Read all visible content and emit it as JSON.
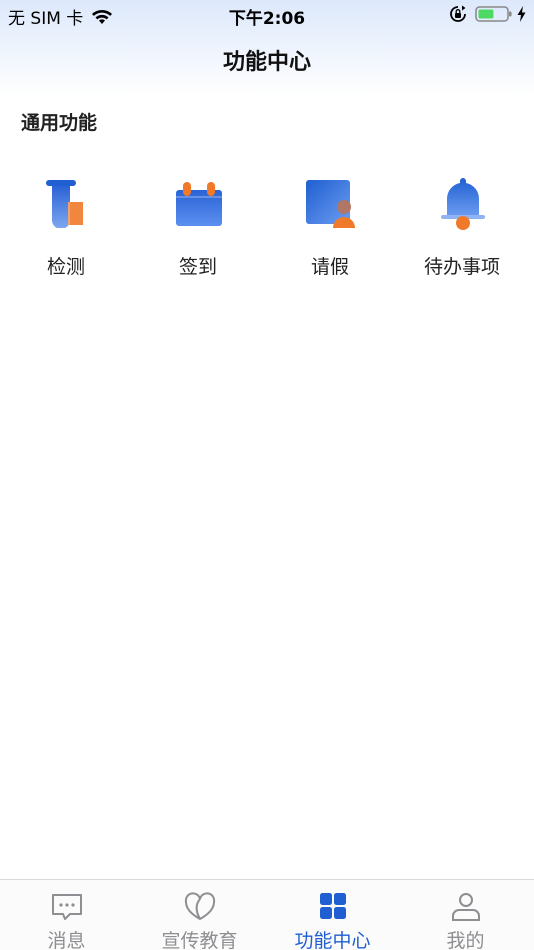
{
  "status_bar": {
    "carrier": "无 SIM 卡",
    "time": "下午2:06",
    "battery_level": 0.55,
    "icons": [
      "wifi-icon",
      "orientation-lock-icon",
      "battery-icon",
      "charging-icon"
    ]
  },
  "header": {
    "title": "功能中心"
  },
  "section": {
    "title": "通用功能"
  },
  "functions": [
    {
      "label": "检测",
      "icon": "test-tube-icon"
    },
    {
      "label": "签到",
      "icon": "calendar-checkin-icon"
    },
    {
      "label": "请假",
      "icon": "leave-request-icon"
    },
    {
      "label": "待办事项",
      "icon": "bell-icon"
    }
  ],
  "tabs": [
    {
      "label": "消息",
      "icon": "message-icon",
      "active": false
    },
    {
      "label": "宣传教育",
      "icon": "education-icon",
      "active": false
    },
    {
      "label": "功能中心",
      "icon": "grid-icon",
      "active": true
    },
    {
      "label": "我的",
      "icon": "profile-icon",
      "active": false
    }
  ],
  "colors": {
    "accent": "#1f5fd1",
    "orange": "#f07a2a",
    "inactive": "#8e8e93"
  }
}
